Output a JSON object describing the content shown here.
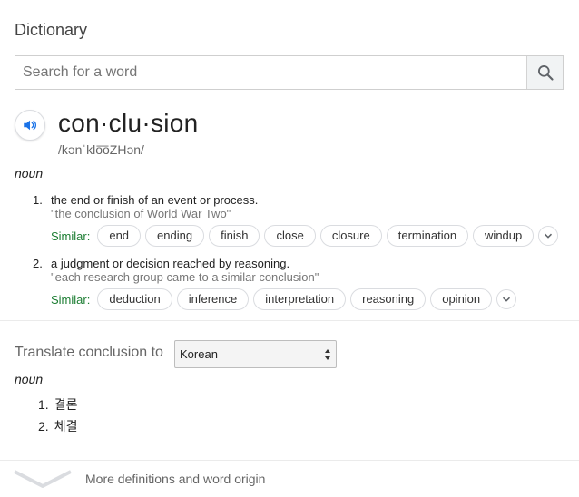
{
  "header": {
    "title": "Dictionary"
  },
  "search": {
    "placeholder": "Search for a word",
    "value": ""
  },
  "entry": {
    "word": "con·clu·sion",
    "phonetic": "/kənˈklo͞oZHən/",
    "part_of_speech": "noun",
    "definitions": [
      {
        "number": "1.",
        "text": "the end or finish of an event or process.",
        "example": "\"the conclusion of World War Two\"",
        "similar_label": "Similar:",
        "similar": [
          "end",
          "ending",
          "finish",
          "close",
          "closure",
          "termination",
          "windup"
        ]
      },
      {
        "number": "2.",
        "text": "a judgment or decision reached by reasoning.",
        "example": "\"each research group came to a similar conclusion\"",
        "similar_label": "Similar:",
        "similar": [
          "deduction",
          "inference",
          "interpretation",
          "reasoning",
          "opinion"
        ]
      }
    ]
  },
  "translate": {
    "label": "Translate conclusion to",
    "selected_language": "Korean",
    "part_of_speech": "noun",
    "items": [
      {
        "number": "1.",
        "text": "결론"
      },
      {
        "number": "2.",
        "text": "체결"
      }
    ]
  },
  "footer": {
    "more_label": "More definitions and word origin"
  },
  "colors": {
    "similar_label": "#1e7e34",
    "speaker_icon": "#1a73e8"
  },
  "icons": {
    "search": "search-icon",
    "speaker": "speaker-icon",
    "chip_more": "chevron-down-icon",
    "footer": "chevron-down-icon"
  }
}
